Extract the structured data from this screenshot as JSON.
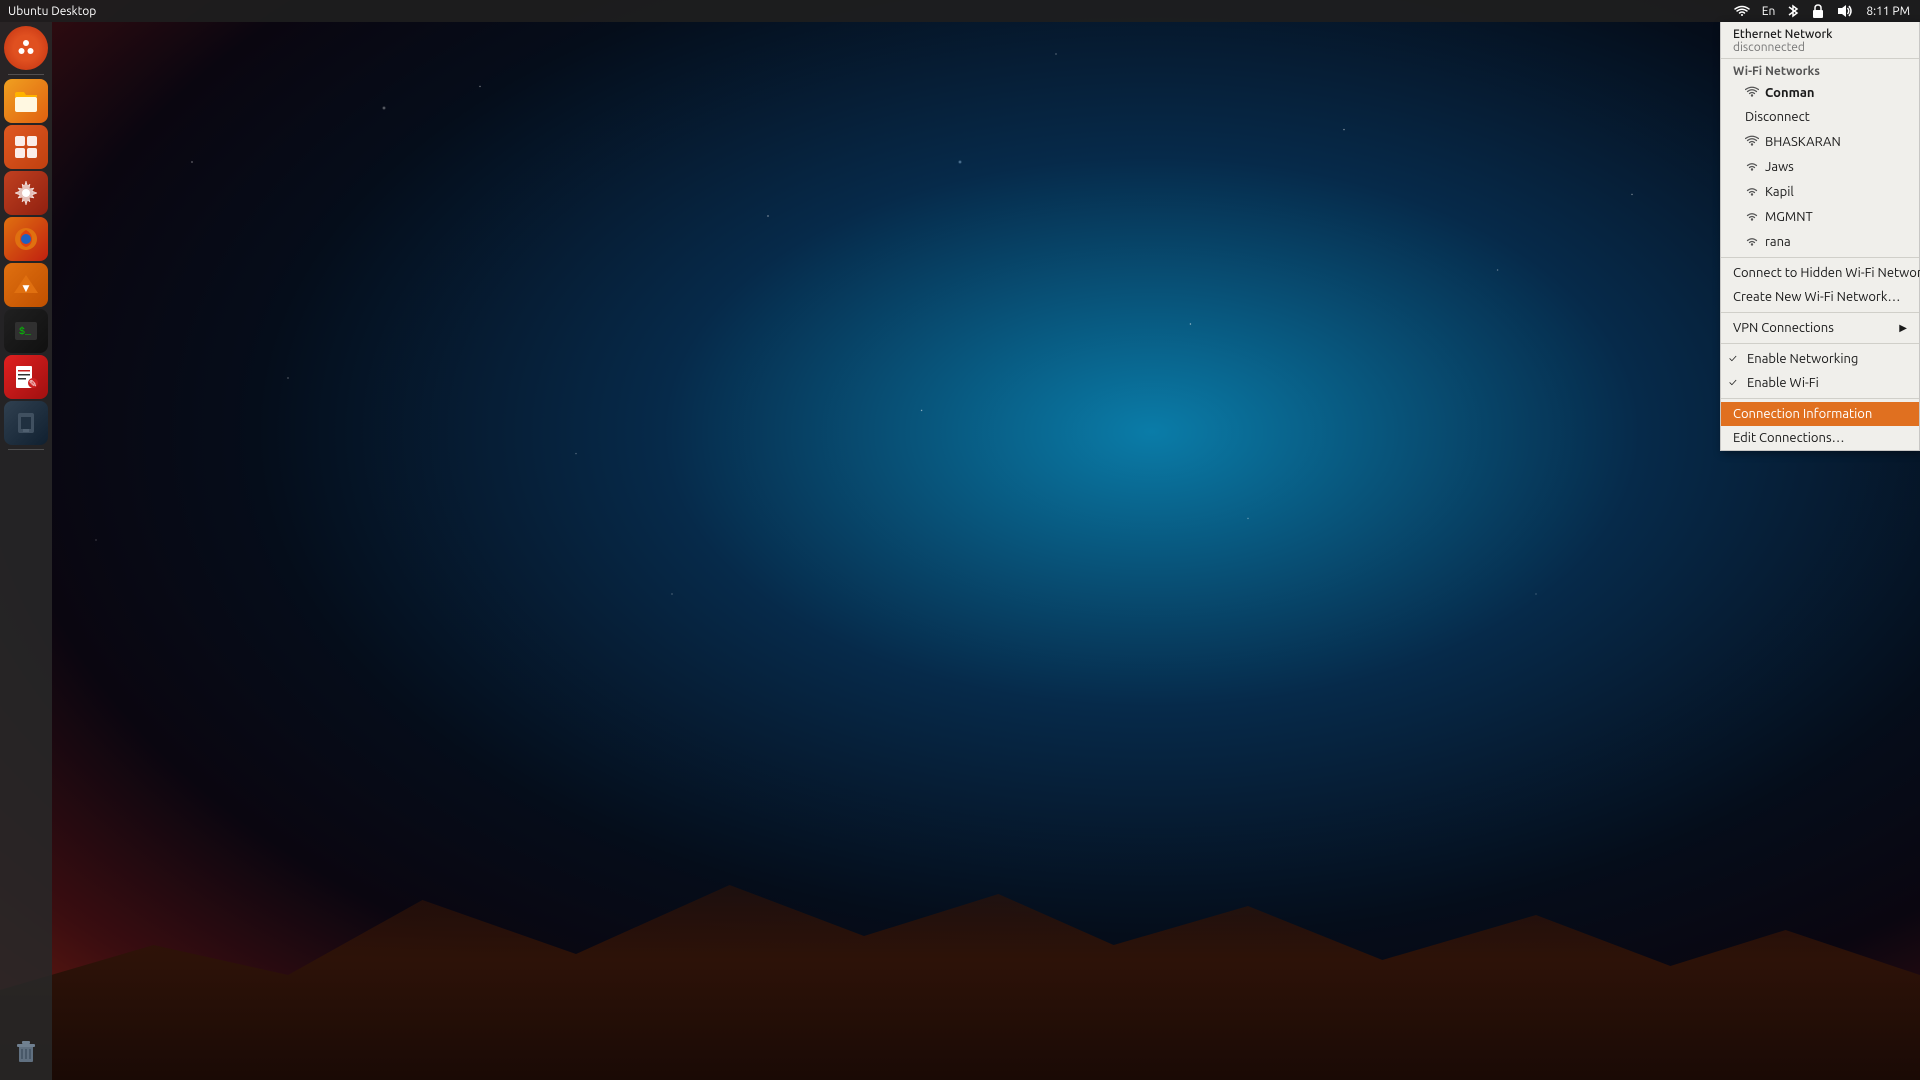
{
  "desktop": {
    "title": "Ubuntu Desktop",
    "bg_description": "Starry night sky over mountains"
  },
  "top_panel": {
    "title": "Ubuntu Desktop",
    "time": "8:11 PM",
    "icons": {
      "wifi": "📶",
      "keyboard": "En",
      "bluetooth": "🔵",
      "lock": "🔒",
      "volume": "🔊"
    }
  },
  "sidebar": {
    "items": [
      {
        "id": "ubuntu-home",
        "label": "Ubuntu Home",
        "icon": "🔴",
        "type": "ubuntu"
      },
      {
        "id": "files",
        "label": "Files",
        "icon": "📁",
        "type": "files"
      },
      {
        "id": "app-center",
        "label": "App Center",
        "icon": "🛍",
        "type": "app-center"
      },
      {
        "id": "settings",
        "label": "Settings",
        "icon": "🔧",
        "type": "settings"
      },
      {
        "id": "firefox",
        "label": "Firefox",
        "icon": "🦊",
        "type": "firefox"
      },
      {
        "id": "vlc",
        "label": "VLC Media Player",
        "icon": "🎬",
        "type": "vlc"
      },
      {
        "id": "terminal",
        "label": "Terminal",
        "icon": "💻",
        "type": "terminal"
      },
      {
        "id": "zim",
        "label": "Zim",
        "icon": "📝",
        "type": "zim"
      },
      {
        "id": "usb",
        "label": "USB Creator",
        "icon": "💾",
        "type": "usb"
      },
      {
        "id": "trash",
        "label": "Trash",
        "icon": "🗑",
        "type": "trash"
      }
    ]
  },
  "network_menu": {
    "ethernet": {
      "label": "Ethernet Network",
      "status": "disconnected"
    },
    "wifi_section_label": "Wi-Fi Networks",
    "connected_network": "Conman",
    "disconnect_label": "Disconnect",
    "networks": [
      {
        "name": "BHASKARAN"
      },
      {
        "name": "Jaws"
      },
      {
        "name": "Kapil"
      },
      {
        "name": "MGMNT"
      },
      {
        "name": "rana"
      }
    ],
    "hidden_wifi_label": "Connect to Hidden Wi-Fi Network…",
    "new_wifi_label": "Create New Wi-Fi Network…",
    "vpn_label": "VPN Connections",
    "enable_networking_label": "Enable Networking",
    "enable_wifi_label": "Enable Wi-Fi",
    "connection_info_label": "Connection Information",
    "edit_connections_label": "Edit Connections…"
  }
}
